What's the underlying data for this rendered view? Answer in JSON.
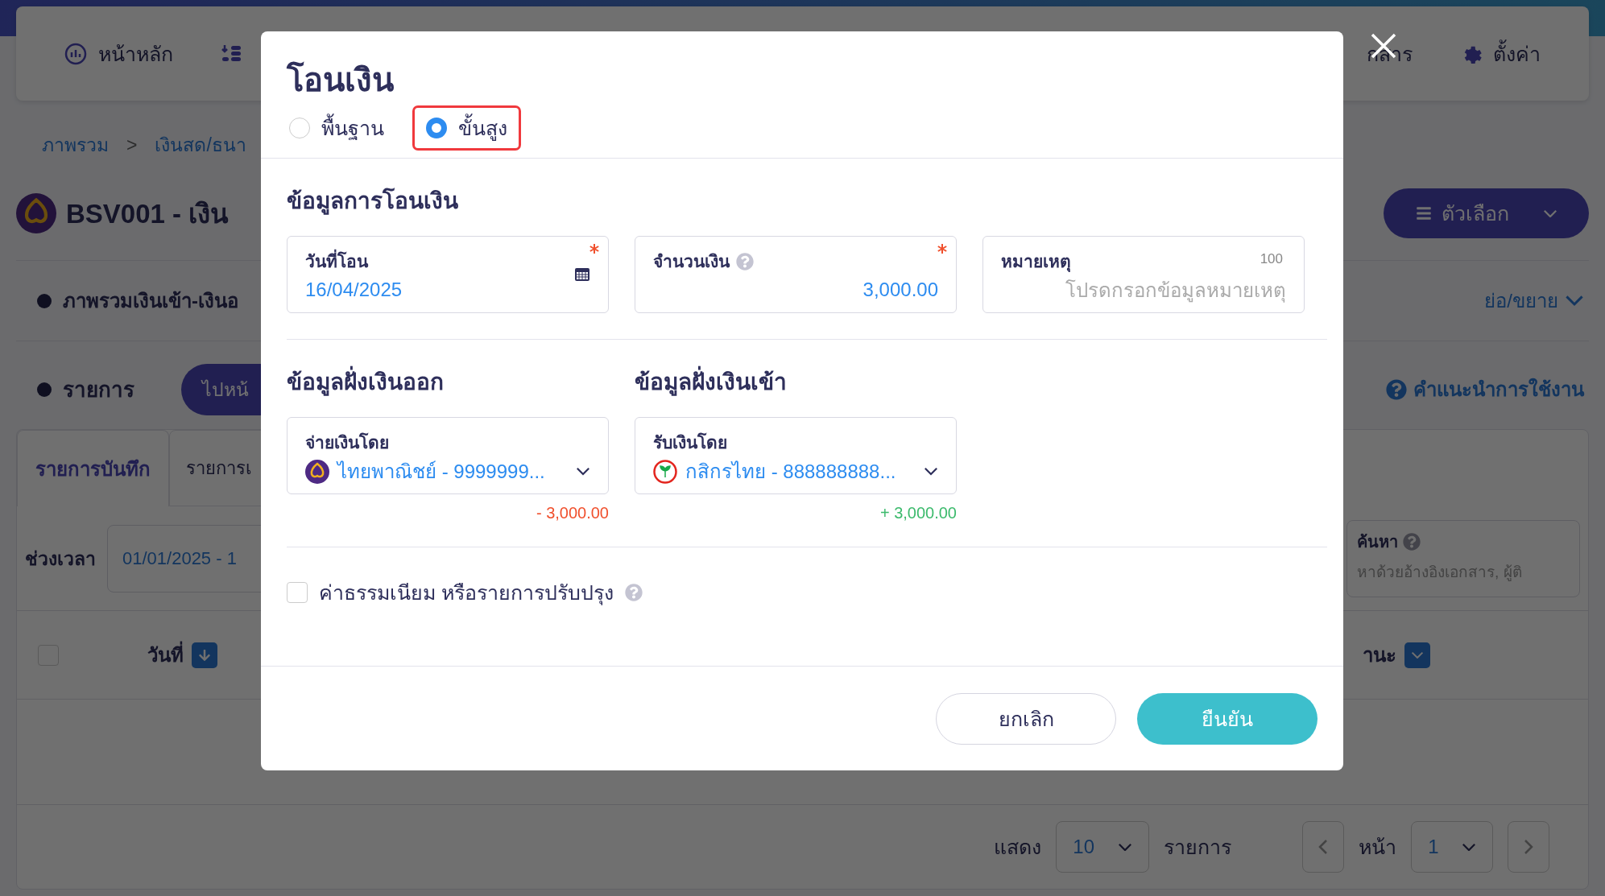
{
  "nav": {
    "items": [
      {
        "kind": "home",
        "label": "หน้าหลัก"
      },
      {
        "kind": "list"
      },
      {
        "kind": "docs",
        "label": "กสาร"
      },
      {
        "kind": "settings",
        "label": "ตั้งค่า"
      }
    ]
  },
  "breadcrumb": {
    "items": [
      "ภาพรวม",
      "เงินสด/ธนา"
    ],
    "separator": ">"
  },
  "page_title": "BSV001 - เงิน",
  "options_button": "ตัวเลือก",
  "overview": {
    "title": "ภาพรวมเงินเข้า-เงินอ",
    "toggle": "ย่อ/ขยาย"
  },
  "list_section": {
    "title": "รายการ",
    "goto_button": "ไปหน้",
    "help_link": "คำแนะนำการใช้งาน"
  },
  "tabs": [
    {
      "label": "รายการบันทึก",
      "selected": true
    },
    {
      "label": "รายการเ",
      "selected": false
    }
  ],
  "filter": {
    "period_label": "ช่วงเวลา",
    "period_value": "01/01/2025 - 1",
    "search_label": "ค้นหา",
    "search_placeholder": "หาด้วยอ้างอิงเอกสาร, ผู้ติ"
  },
  "table": {
    "columns": [
      "วันที่",
      "านะ"
    ],
    "select_all_checked": false
  },
  "pagination": {
    "show_label": "แสดง",
    "page_size": "10",
    "items_label": "รายการ",
    "page_label": "หน้า",
    "page": "1"
  },
  "modal": {
    "title": "โอนเงิน",
    "modes": [
      {
        "label": "พื้นฐาน",
        "selected": false
      },
      {
        "label": "ขั้นสูง",
        "selected": true
      }
    ],
    "section_title": "ข้อมูลการโอนเงิน",
    "date_field": {
      "label": "วันที่โอน",
      "value": "16/04/2025",
      "required": true
    },
    "amount_field": {
      "label": "จำนวนเงิน",
      "value": "3,000.00",
      "required": true
    },
    "note_field": {
      "label": "หมายเหตุ",
      "counter": "100",
      "placeholder": "โปรดกรอกข้อมูลหมายเหตุ"
    },
    "accounts": [
      {
        "kind": "out",
        "title": "ข้อมูลฝั่งเงินออก",
        "label": "จ่ายเงินโดย",
        "value": "ไทยพาณิชย์ - 9999999...",
        "logo": {
          "kind": "scb"
        },
        "amount": "- 3,000.00"
      },
      {
        "kind": "in",
        "title": "ข้อมูลฝั่งเงินเข้า",
        "label": "รับเงินโดย",
        "value": "กสิกรไทย - 888888888...",
        "logo": {
          "kind": "kbank"
        },
        "amount": "+ 3,000.00"
      }
    ],
    "fee_checkbox": {
      "label": "ค่าธรรมเนียม หรือรายการปรับปรุง",
      "checked": false
    },
    "buttons": {
      "cancel": "ยกเลิก",
      "confirm": "ยืนยัน"
    }
  }
}
